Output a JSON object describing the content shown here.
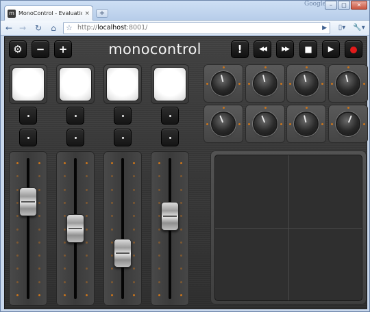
{
  "browser": {
    "tab_title": "MonoControl - Evaluation V...",
    "tab_favicon": "m",
    "tab_close": "×",
    "new_tab": "+",
    "brand": "Google",
    "window_buttons": {
      "minimize": "–",
      "maximize": "□",
      "close": "✕"
    },
    "nav": {
      "back": "←",
      "forward": "→",
      "reload": "↻",
      "home": "⌂"
    },
    "address": {
      "protocol": "http://",
      "host": "localhost",
      "rest": ":8001/"
    },
    "go_icon": "▶",
    "page_menu": "▯▾",
    "tools_menu": "🔧▾"
  },
  "app": {
    "logo": "monocontrol",
    "left_buttons": [
      {
        "name": "settings-button",
        "glyph": "⚙"
      },
      {
        "name": "minus-button",
        "glyph": "−"
      },
      {
        "name": "plus-button",
        "glyph": "+"
      }
    ],
    "transport": [
      {
        "name": "alert-button",
        "glyph": "!"
      },
      {
        "name": "rewind-button",
        "glyph": "◀◀"
      },
      {
        "name": "fast-forward-button",
        "glyph": "▶▶"
      },
      {
        "name": "stop-button",
        "glyph": "■"
      },
      {
        "name": "play-button",
        "glyph": "▶"
      },
      {
        "name": "record-button",
        "glyph": ""
      }
    ],
    "record_color": "#e21a1a",
    "accent_dot_color": "#c8741c",
    "faders": [
      {
        "level": 0.74
      },
      {
        "level": 0.5
      },
      {
        "level": 0.28
      },
      {
        "level": 0.61
      }
    ],
    "knobs": [
      {
        "value": 0.45
      },
      {
        "value": 0.45
      },
      {
        "value": 0.45
      },
      {
        "value": 0.45
      },
      {
        "value": 0.42
      },
      {
        "value": 0.42
      },
      {
        "value": 0.45
      },
      {
        "value": 0.58
      }
    ]
  }
}
